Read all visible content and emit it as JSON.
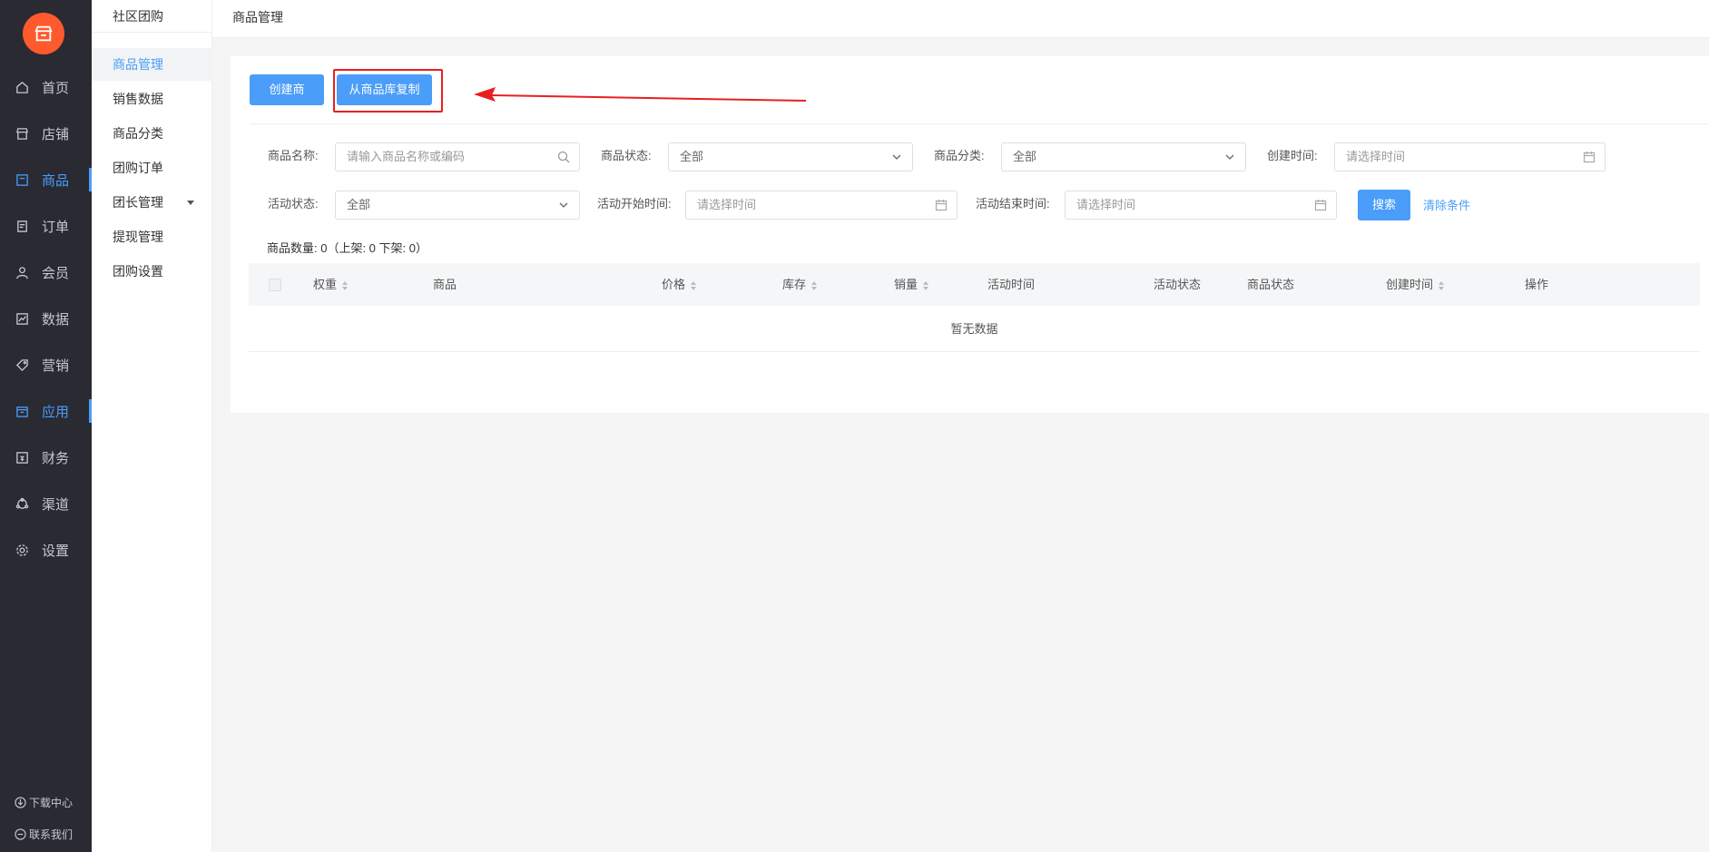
{
  "nav": {
    "items": [
      {
        "label": "首页",
        "icon": "home-icon"
      },
      {
        "label": "店铺",
        "icon": "store-icon"
      },
      {
        "label": "商品",
        "icon": "goods-icon"
      },
      {
        "label": "订单",
        "icon": "order-icon"
      },
      {
        "label": "会员",
        "icon": "member-icon"
      },
      {
        "label": "数据",
        "icon": "chart-icon"
      },
      {
        "label": "营销",
        "icon": "tag-icon"
      },
      {
        "label": "应用",
        "icon": "app-icon"
      },
      {
        "label": "财务",
        "icon": "finance-icon"
      },
      {
        "label": "渠道",
        "icon": "channel-icon"
      },
      {
        "label": "设置",
        "icon": "gear-icon"
      }
    ],
    "download": "下载中心",
    "contact": "联系我们"
  },
  "subnav": {
    "title": "社区团购",
    "items": [
      "商品管理",
      "销售数据",
      "商品分类",
      "团购订单",
      "团长管理",
      "提现管理",
      "团购设置"
    ]
  },
  "header": {
    "breadcrumb": "商品管理"
  },
  "toolbar": {
    "create_label": "创建商品",
    "copy_label": "从商品库复制"
  },
  "filters": {
    "name_label": "商品名称:",
    "name_placeholder": "请输入商品名称或编码",
    "status_label": "商品状态:",
    "status_value": "全部",
    "category_label": "商品分类:",
    "category_value": "全部",
    "created_label": "创建时间:",
    "created_placeholder": "请选择时间",
    "activity_status_label": "活动状态:",
    "activity_status_value": "全部",
    "start_label": "活动开始时间:",
    "start_placeholder": "请选择时间",
    "end_label": "活动结束时间:",
    "end_placeholder": "请选择时间",
    "search_label": "搜索",
    "clear_label": "清除条件"
  },
  "summary": {
    "count_text": "商品数量: 0（上架: 0 下架: 0）"
  },
  "table": {
    "columns": [
      "权重",
      "商品",
      "价格",
      "库存",
      "销量",
      "活动时间",
      "活动状态",
      "商品状态",
      "创建时间",
      "操作"
    ],
    "empty_text": "暂无数据"
  },
  "colors": {
    "accent": "#4a9df8",
    "logo": "#ff5a2d",
    "highlight": "#e62020",
    "nav_bg": "#2a2a33"
  }
}
